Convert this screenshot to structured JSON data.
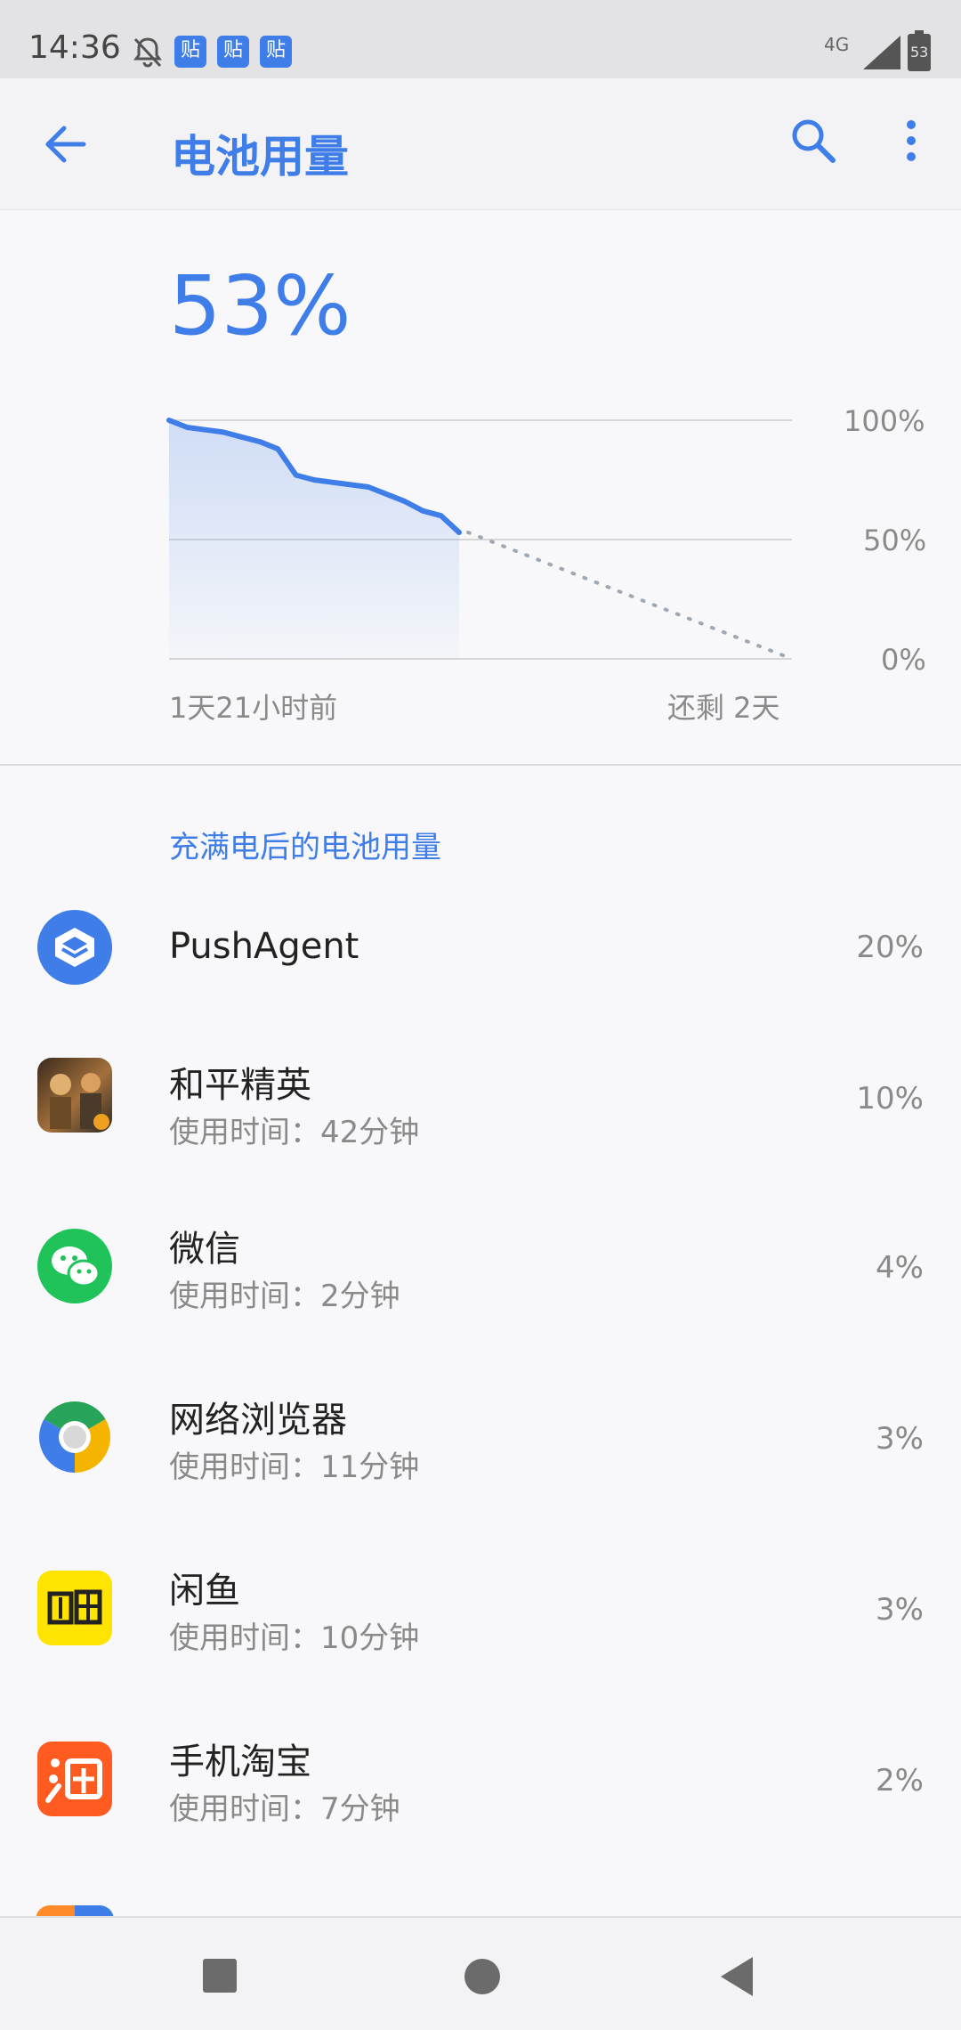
{
  "status_bar": {
    "time": "14:36",
    "notifications": [
      "贴",
      "贴",
      "贴"
    ],
    "network": "4G",
    "battery_level": "53"
  },
  "app_bar": {
    "back_icon": "arrow-back-icon",
    "title": "电池用量",
    "search_icon": "search-icon",
    "more_icon": "more-vert-icon"
  },
  "summary": {
    "battery_percent": "53%"
  },
  "chart_data": {
    "type": "line",
    "y_ticks": [
      "100%",
      "50%",
      "0%"
    ],
    "x_start_label": "1天21小时前",
    "x_end_label": "还剩 2天",
    "ylim": [
      0,
      100
    ],
    "series": [
      {
        "values": [
          100,
          97,
          96,
          95,
          93,
          91,
          88,
          77,
          75,
          74,
          73,
          72,
          69,
          66,
          62,
          60,
          53
        ]
      }
    ],
    "projection": {
      "from": 53,
      "to": 0
    },
    "accent_color": "#3f7de8",
    "grid": true
  },
  "section_header": "充满电后的电池用量",
  "apps": [
    {
      "name": "PushAgent",
      "usage": "",
      "percent": "20%",
      "icon": "pushagent-icon"
    },
    {
      "name": "和平精英",
      "usage": "使用时间：42分钟",
      "percent": "10%",
      "icon": "peace-elite-icon"
    },
    {
      "name": "微信",
      "usage": "使用时间：2分钟",
      "percent": "4%",
      "icon": "wechat-icon"
    },
    {
      "name": "网络浏览器",
      "usage": "使用时间：11分钟",
      "percent": "3%",
      "icon": "browser-icon"
    },
    {
      "name": "闲鱼",
      "usage": "使用时间：10分钟",
      "percent": "3%",
      "icon": "xianyu-icon"
    },
    {
      "name": "手机淘宝",
      "usage": "使用时间：7分钟",
      "percent": "2%",
      "icon": "taobao-icon"
    }
  ],
  "nav_bar": {
    "recent_icon": "recent-apps-icon",
    "home_icon": "home-icon",
    "back_icon": "nav-back-icon"
  }
}
